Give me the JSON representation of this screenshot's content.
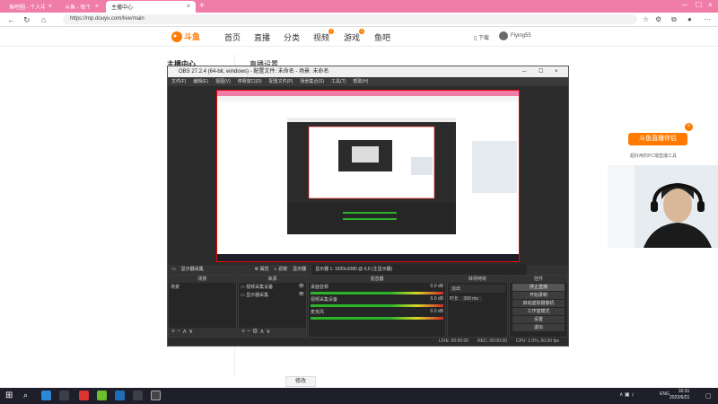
{
  "browser": {
    "tabs": [
      {
        "label": "鱼吧圈 - 个人中心 - 斗鱼"
      },
      {
        "label": "斗鱼 - 每个人的直播平台"
      },
      {
        "label": "主播中心"
      }
    ],
    "url": "https://mp.douyu.com/live/main"
  },
  "site": {
    "logo_text": "斗鱼",
    "nav": [
      "首页",
      "直播",
      "分类",
      "视频",
      "游戏",
      "鱼吧"
    ],
    "nav_badges": {
      "视频": "4",
      "游戏": "1"
    },
    "download": "下载",
    "username": "Flying55"
  },
  "page": {
    "sidebar_title": "主播中心",
    "content_title": "直播设置",
    "bottom_button": "修改"
  },
  "obs": {
    "title": "OBS 27.2.4 (64-bit, windows) - 配置文件: 未命名 - 场景: 未命名",
    "menu": [
      "文件(F)",
      "编辑(E)",
      "视图(V)",
      "停靠窗口(D)",
      "配置文件(P)",
      "场景集合(S)",
      "工具(T)",
      "帮助(H)"
    ],
    "source_bar": {
      "selected_source": "显示器采集",
      "buttons": [
        "属性",
        "滤镜",
        "显示器"
      ],
      "display_value": "显示器 1: 1920x1080 @ 0,0 (主显示器)"
    },
    "scenes": {
      "header": "场景",
      "items": [
        "场景"
      ]
    },
    "sources": {
      "header": "来源",
      "items": [
        "视频采集设备",
        "显示器采集"
      ]
    },
    "mixer": {
      "header": "混音器",
      "channels": [
        {
          "name": "桌面音频",
          "db": "0.0 dB"
        },
        {
          "name": "视频采集设备",
          "db": "0.0 dB"
        },
        {
          "name": "麦克风",
          "db": "0.0 dB"
        }
      ]
    },
    "transitions": {
      "header": "转场特效",
      "type": "淡出",
      "duration_label": "时长",
      "duration": "300 ms"
    },
    "controls": {
      "header": "控件",
      "buttons": [
        "停止直播",
        "开始录制",
        "启动虚拟摄像机",
        "工作室模式",
        "设置",
        "退出"
      ]
    },
    "status": {
      "live": "LIVE: 00:00:00",
      "rec": "REC: 00:00:00",
      "cpu": "CPU: 1.0%, 60.00 fps"
    }
  },
  "promo": {
    "title": "斗鱼直播伴侣",
    "subtitle": "超好用的PC端直播工具"
  },
  "taskbar": {
    "tray": "ENG",
    "time": "16:31",
    "date": "2022/6/21"
  },
  "colors": {
    "tabbar": "#f07ca8",
    "brand": "#ff7a00",
    "obs_bg": "#2b2b2b",
    "preview_border": "#e00000",
    "taskbar": "#1f1f2b"
  }
}
